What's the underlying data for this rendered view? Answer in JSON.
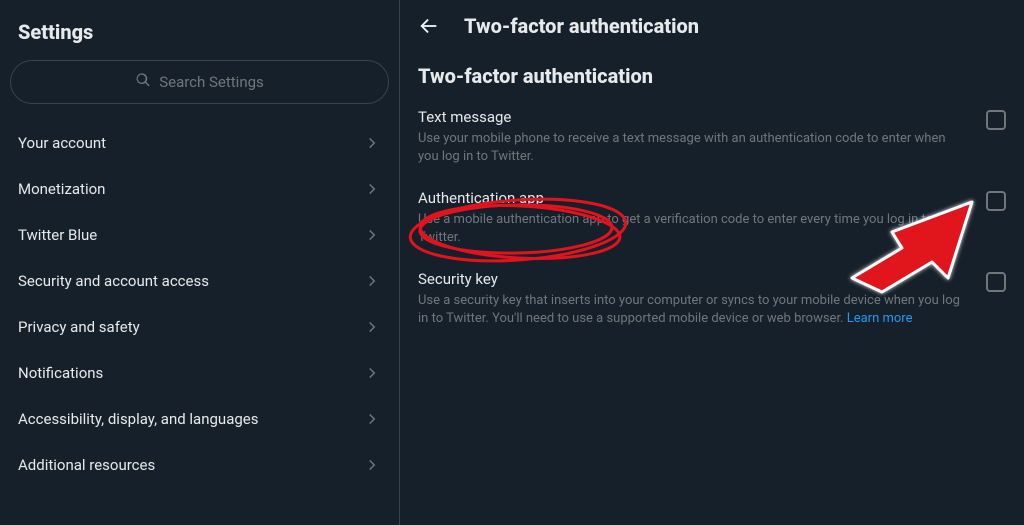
{
  "sidebar": {
    "title": "Settings",
    "searchPlaceholder": "Search Settings",
    "items": [
      {
        "label": "Your account"
      },
      {
        "label": "Monetization"
      },
      {
        "label": "Twitter Blue"
      },
      {
        "label": "Security and account access"
      },
      {
        "label": "Privacy and safety"
      },
      {
        "label": "Notifications"
      },
      {
        "label": "Accessibility, display, and languages"
      },
      {
        "label": "Additional resources"
      }
    ]
  },
  "main": {
    "headerTitle": "Two-factor authentication",
    "sectionTitle": "Two-factor authentication",
    "options": [
      {
        "title": "Text message",
        "desc": "Use your mobile phone to receive a text message with an authentication code to enter when you log in to Twitter."
      },
      {
        "title": "Authentication app",
        "desc": "Use a mobile authentication app to get a verification code to enter every time you log in to Twitter."
      },
      {
        "title": "Security key",
        "descPrefix": "Use a security key that inserts into your computer or syncs to your mobile device when you log in to Twitter. You'll need to use a supported mobile device or web browser. ",
        "learnMore": "Learn more"
      }
    ]
  }
}
